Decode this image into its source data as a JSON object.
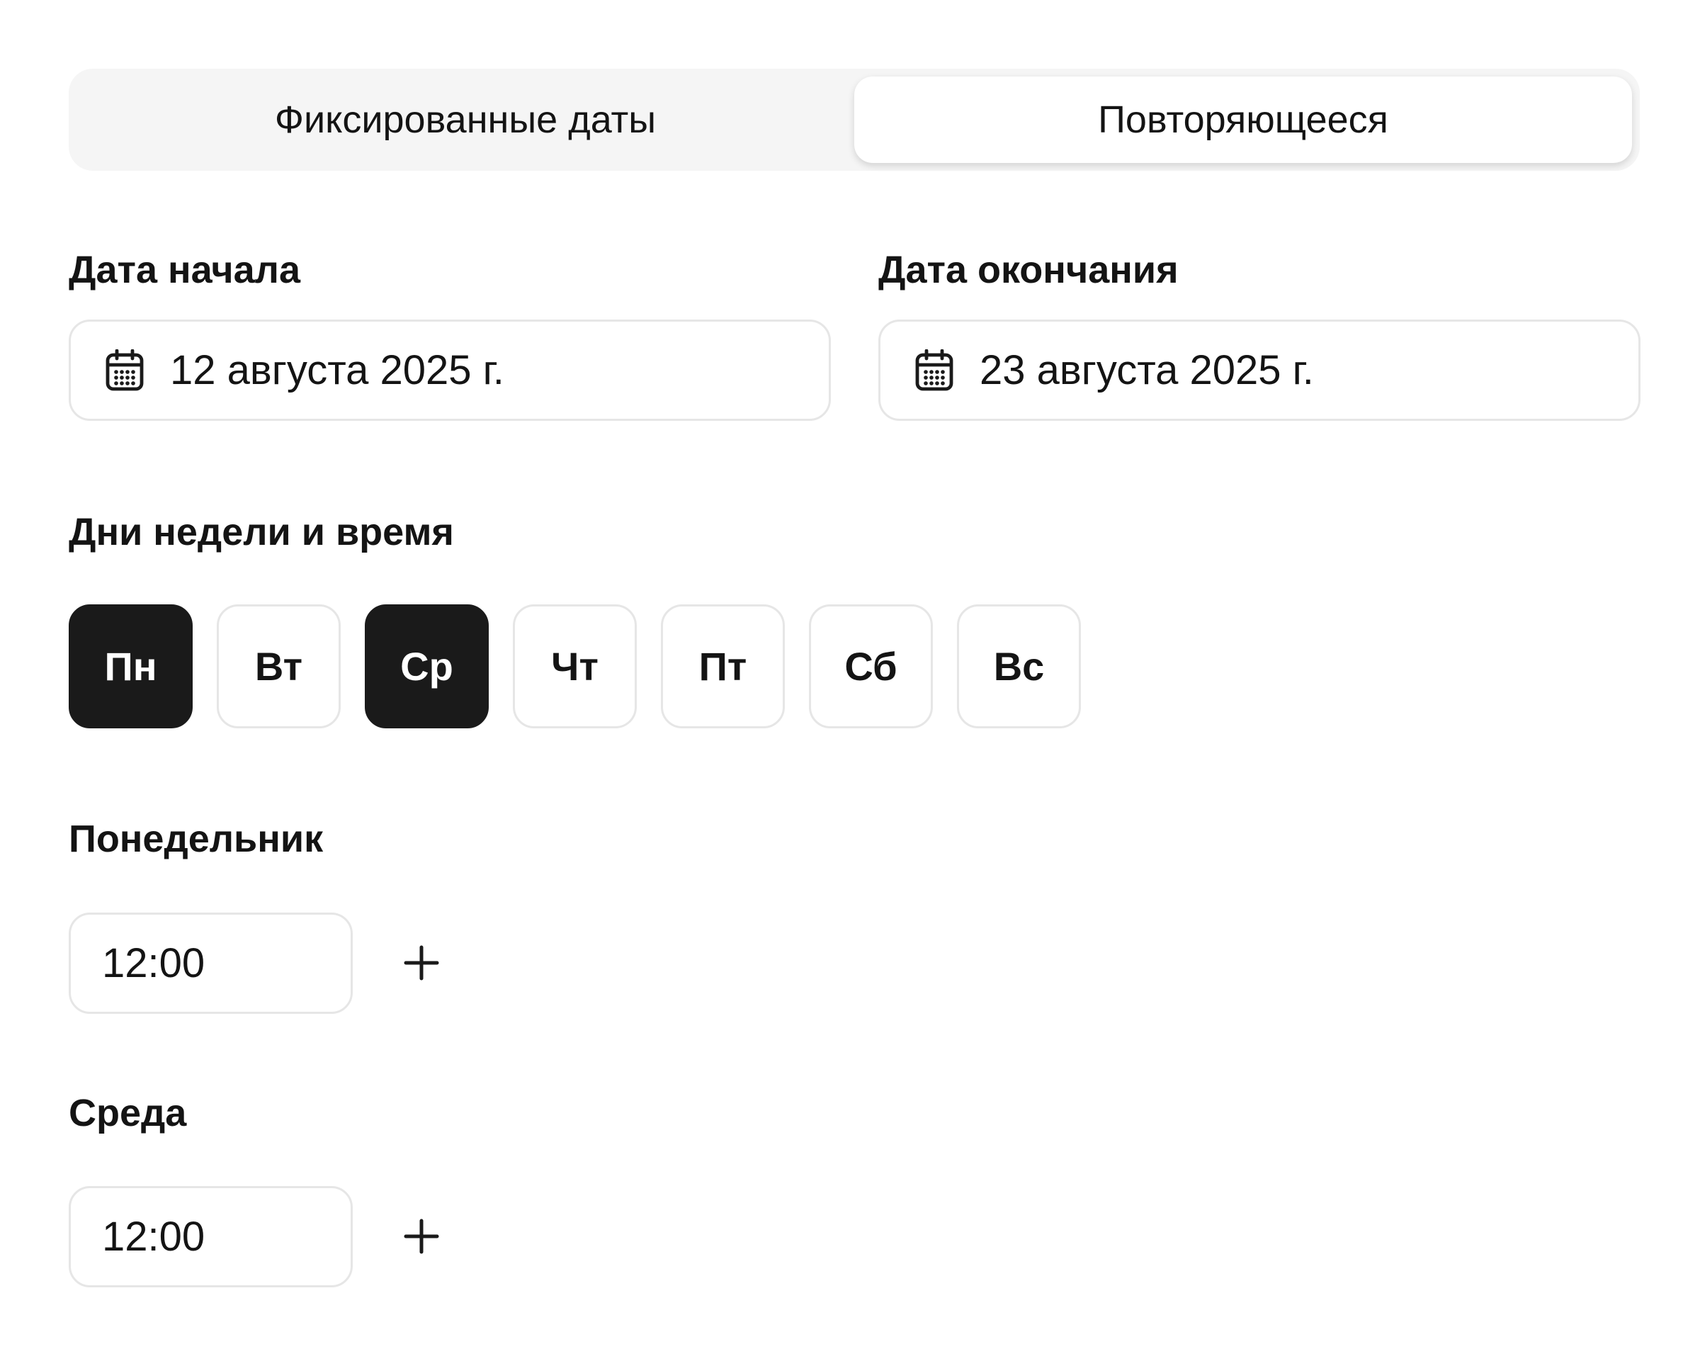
{
  "tabs": [
    {
      "label": "Фиксированные даты",
      "active": false
    },
    {
      "label": "Повторяющееся",
      "active": true
    }
  ],
  "start_date": {
    "label": "Дата начала",
    "value": "12 августа 2025 г.",
    "icon": "calendar-icon"
  },
  "end_date": {
    "label": "Дата окончания",
    "value": "23 августа 2025 г.",
    "icon": "calendar-icon"
  },
  "weekdays": {
    "label": "Дни недели и время",
    "days": [
      {
        "label": "Пн",
        "selected": true
      },
      {
        "label": "Вт",
        "selected": false
      },
      {
        "label": "Ср",
        "selected": true
      },
      {
        "label": "Чт",
        "selected": false
      },
      {
        "label": "Пт",
        "selected": false
      },
      {
        "label": "Сб",
        "selected": false
      },
      {
        "label": "Вс",
        "selected": false
      }
    ]
  },
  "schedule": [
    {
      "day": "Понедельник",
      "time": "12:00",
      "add_icon": "plus-icon"
    },
    {
      "day": "Среда",
      "time": "12:00",
      "add_icon": "plus-icon"
    }
  ],
  "colors": {
    "selected_chip": "#1a1a1a",
    "segmented_bg": "#f5f5f5",
    "border": "#e6e6e6"
  }
}
